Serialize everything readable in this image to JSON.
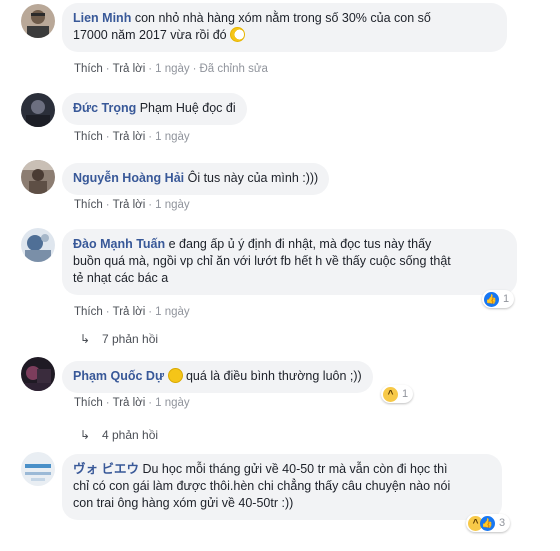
{
  "comments": [
    {
      "author": "Lien Minh",
      "text_line1": "con nhỏ nhà hàng xóm nằm trong số 30% của con số",
      "text_line2": "17000 năm 2017 vừa rồi đó",
      "emoji": "moon-face-emoji",
      "actions": {
        "like": "Thích",
        "reply": "Trả lời",
        "time": "1 ngày",
        "edited": "Đã chỉnh sửa"
      }
    },
    {
      "author": "Đức Trọng",
      "text": "Phạm Huệ đọc đi",
      "actions": {
        "like": "Thích",
        "reply": "Trả lời",
        "time": "1 ngày"
      }
    },
    {
      "author": "Nguyễn Hoàng Hải",
      "text": "Ôi tus này của mình :)))",
      "actions": {
        "like": "Thích",
        "reply": "Trả lời",
        "time": "1 ngày"
      }
    },
    {
      "author": "Đào Mạnh Tuấn",
      "text_line1": "e đang ấp ủ ý định đi nhật, mà đọc tus này thấy",
      "text_line2": "buồn quá mà, ngồi vp chỉ ăn với lướt fb hết h về thấy cuộc sống thật",
      "text_line3": "tẻ nhạt các bác a",
      "reaction_count": "1",
      "actions": {
        "like": "Thích",
        "reply": "Trả lời",
        "time": "1 ngày"
      },
      "replies": "7 phản hồi"
    },
    {
      "author": "Phạm Quốc Dự",
      "text": "quá là điều bình thường luôn ;))",
      "emoji": "smirk-emoji",
      "reaction_count": "1",
      "actions": {
        "like": "Thích",
        "reply": "Trả lời",
        "time": "1 ngày"
      },
      "replies": "4 phản hồi"
    },
    {
      "author": "ヴォ ビエウ",
      "text_line1": "Du học mỗi tháng gửi về 40-50 tr mà vẫn còn đi học thì",
      "text_line2": "chỉ có con gái làm được thôi.hèn chi chẳng thấy câu chuyện nào nói",
      "text_line3": "con trai ông hàng xóm gửi về 40-50tr :))",
      "reaction_count": "3"
    }
  ],
  "colors": {
    "author": "#385898",
    "bubble": "#f2f3f5",
    "meta": "#90949c",
    "like": "#1877f2",
    "haha": "#f7c948"
  }
}
